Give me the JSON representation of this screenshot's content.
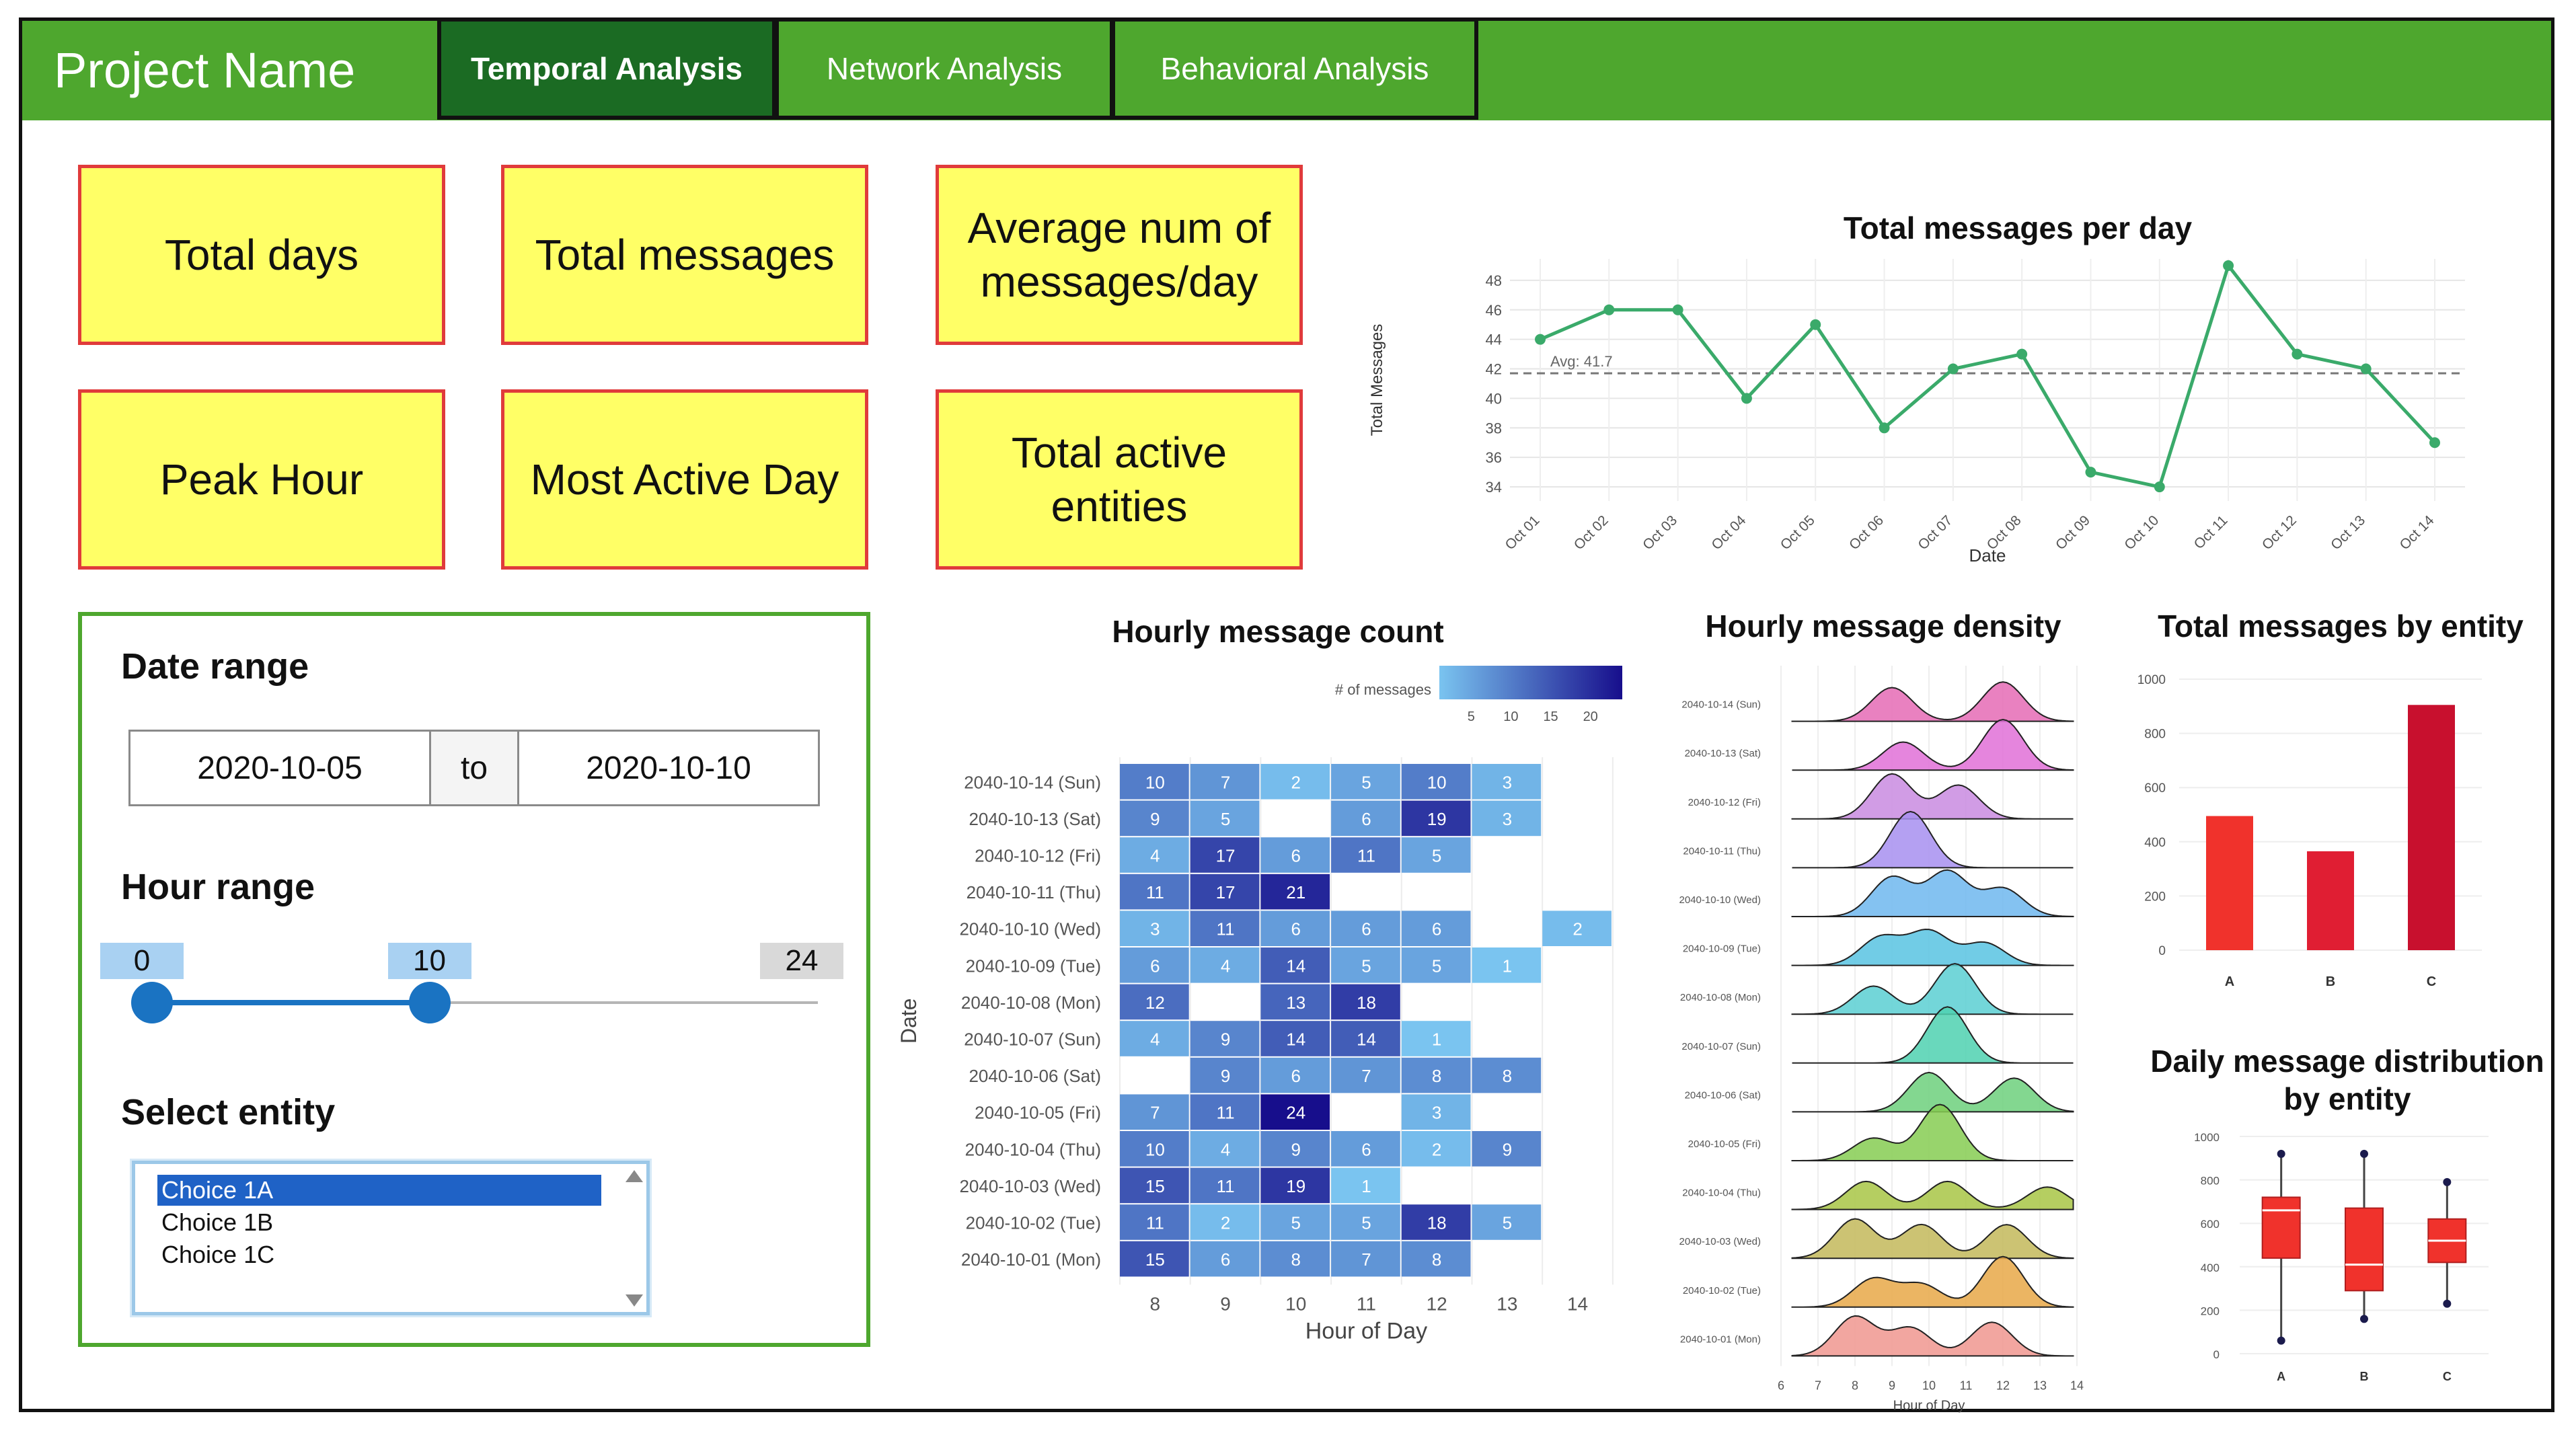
{
  "app": {
    "title": "Project Name"
  },
  "tabs": [
    {
      "label": "Temporal Analysis",
      "active": true
    },
    {
      "label": "Network Analysis",
      "active": false
    },
    {
      "label": "Behavioral Analysis",
      "active": false
    }
  ],
  "kpis": [
    "Total days",
    "Total messages",
    "Average num of messages/day",
    "Peak Hour",
    "Most Active Day",
    "Total active entities"
  ],
  "filters": {
    "date_range_label": "Date range",
    "date_start": "2020-10-05",
    "date_to": "to",
    "date_end": "2020-10-10",
    "hour_range_label": "Hour range",
    "hour_min": "0",
    "hour_low": "10",
    "hour_max": "24",
    "hour_low_fraction": 0.4167,
    "select_entity_label": "Select entity",
    "entity_options": [
      "Choice 1A",
      "Choice 1B",
      "Choice 1C"
    ],
    "selected_entity": "Choice 1A"
  },
  "colors": {
    "bar_green": "#4ea72e",
    "active_tab": "#1b6b23",
    "kpi_fill": "#ffff66",
    "kpi_border": "#e03b3b",
    "slider_blue": "#1a73c2",
    "line_green": "#3aaa6a"
  },
  "chart_data": [
    {
      "type": "line",
      "title": "Total messages per day",
      "xlabel": "Date",
      "ylabel": "Total Messages",
      "x": [
        "Oct 01",
        "Oct 02",
        "Oct 03",
        "Oct 04",
        "Oct 05",
        "Oct 06",
        "Oct 07",
        "Oct 08",
        "Oct 09",
        "Oct 10",
        "Oct 11",
        "Oct 12",
        "Oct 13",
        "Oct 14"
      ],
      "values": [
        44,
        46,
        46,
        40,
        45,
        38,
        42,
        43,
        35,
        34,
        49,
        43,
        42,
        37
      ],
      "ylim": [
        33.5,
        49
      ],
      "yticks": [
        34,
        36,
        38,
        40,
        42,
        44,
        46,
        48
      ],
      "reference_line": {
        "label": "Avg: 41.7",
        "value": 41.7
      },
      "grid": true
    },
    {
      "type": "heatmap",
      "title": "Hourly message count",
      "xlabel": "Hour of Day",
      "ylabel": "Date",
      "legend_title": "# of messages",
      "legend_ticks": [
        "5",
        "10",
        "15",
        "20"
      ],
      "x": [
        "8",
        "9",
        "10",
        "11",
        "12",
        "13",
        "14"
      ],
      "rows": [
        "2040-10-14 (Sun)",
        "2040-10-13 (Sat)",
        "2040-10-12 (Fri)",
        "2040-10-11 (Thu)",
        "2040-10-10 (Wed)",
        "2040-10-09 (Tue)",
        "2040-10-08 (Mon)",
        "2040-10-07 (Sun)",
        "2040-10-06 (Sat)",
        "2040-10-05 (Fri)",
        "2040-10-04 (Thu)",
        "2040-10-03 (Wed)",
        "2040-10-02 (Tue)",
        "2040-10-01 (Mon)"
      ],
      "cells": [
        [
          10,
          7,
          2,
          5,
          10,
          3,
          null
        ],
        [
          9,
          5,
          null,
          6,
          19,
          3,
          null
        ],
        [
          4,
          17,
          6,
          11,
          5,
          null,
          null
        ],
        [
          11,
          17,
          21,
          null,
          null,
          null,
          null
        ],
        [
          3,
          11,
          6,
          6,
          6,
          null,
          2
        ],
        [
          6,
          4,
          14,
          5,
          5,
          1,
          null
        ],
        [
          12,
          null,
          13,
          18,
          null,
          null,
          null
        ],
        [
          4,
          9,
          14,
          14,
          1,
          null,
          null
        ],
        [
          null,
          9,
          6,
          7,
          8,
          8,
          null
        ],
        [
          7,
          11,
          24,
          null,
          3,
          null,
          null
        ],
        [
          10,
          4,
          9,
          6,
          2,
          9,
          null
        ],
        [
          15,
          11,
          19,
          1,
          null,
          null,
          null
        ],
        [
          11,
          2,
          5,
          5,
          18,
          5,
          null
        ],
        [
          15,
          6,
          8,
          7,
          8,
          null,
          null
        ]
      ]
    },
    {
      "type": "area",
      "title": "Hourly message density",
      "xlabel": "Hour of Day",
      "x_ticks": [
        "6",
        "7",
        "8",
        "9",
        "10",
        "11",
        "12",
        "13",
        "14"
      ],
      "rows": [
        "2040-10-14 (Sun)",
        "2040-10-13 (Sat)",
        "2040-10-12 (Fri)",
        "2040-10-11 (Thu)",
        "2040-10-10 (Wed)",
        "2040-10-09 (Tue)",
        "2040-10-08 (Mon)",
        "2040-10-07 (Sun)",
        "2040-10-06 (Sat)",
        "2040-10-05 (Fri)",
        "2040-10-04 (Thu)",
        "2040-10-03 (Wed)",
        "2040-10-02 (Tue)",
        "2040-10-01 (Mon)"
      ],
      "peaks": [
        [
          [
            9.0,
            0.6
          ],
          [
            12.0,
            0.7
          ]
        ],
        [
          [
            9.3,
            0.5
          ],
          [
            12.0,
            0.9
          ]
        ],
        [
          [
            9.0,
            0.8
          ],
          [
            10.8,
            0.6
          ]
        ],
        [
          [
            9.5,
            1.0
          ]
        ],
        [
          [
            9.0,
            0.7
          ],
          [
            10.5,
            0.8
          ],
          [
            12.0,
            0.5
          ]
        ],
        [
          [
            8.7,
            0.5
          ],
          [
            10.0,
            0.6
          ],
          [
            11.5,
            0.4
          ]
        ],
        [
          [
            8.5,
            0.5
          ],
          [
            10.7,
            0.9
          ]
        ],
        [
          [
            10.5,
            1.0
          ]
        ],
        [
          [
            10.0,
            0.7
          ],
          [
            12.3,
            0.6
          ]
        ],
        [
          [
            8.5,
            0.4
          ],
          [
            10.3,
            1.0
          ]
        ],
        [
          [
            8.3,
            0.5
          ],
          [
            10.5,
            0.5
          ],
          [
            13.2,
            0.4
          ]
        ],
        [
          [
            8.0,
            0.7
          ],
          [
            9.8,
            0.6
          ],
          [
            12.1,
            0.6
          ]
        ],
        [
          [
            8.5,
            0.5
          ],
          [
            9.8,
            0.4
          ],
          [
            12.0,
            0.9
          ]
        ],
        [
          [
            8.0,
            0.7
          ],
          [
            9.5,
            0.5
          ],
          [
            11.7,
            0.6
          ]
        ]
      ]
    },
    {
      "type": "bar",
      "title": "Total messages by entity",
      "categories": [
        "A",
        "B",
        "C"
      ],
      "values": [
        495,
        365,
        905
      ],
      "ylim": [
        0,
        1000
      ],
      "yticks": [
        0,
        200,
        400,
        600,
        800,
        1000
      ],
      "colors": [
        "#f0322c",
        "#e01e33",
        "#c8102e"
      ]
    },
    {
      "type": "bar",
      "subtype": "boxplot",
      "title": "Daily message distribution by entity",
      "categories": [
        "A",
        "B",
        "C"
      ],
      "boxes": [
        {
          "min": 60,
          "q1": 440,
          "median": 660,
          "q3": 720,
          "max": 920
        },
        {
          "min": 160,
          "q1": 290,
          "median": 410,
          "q3": 670,
          "max": 920
        },
        {
          "min": 230,
          "q1": 420,
          "median": 520,
          "q3": 620,
          "max": 790
        }
      ],
      "ylim": [
        0,
        1000
      ],
      "yticks": [
        0,
        200,
        400,
        600,
        800,
        1000
      ]
    }
  ]
}
